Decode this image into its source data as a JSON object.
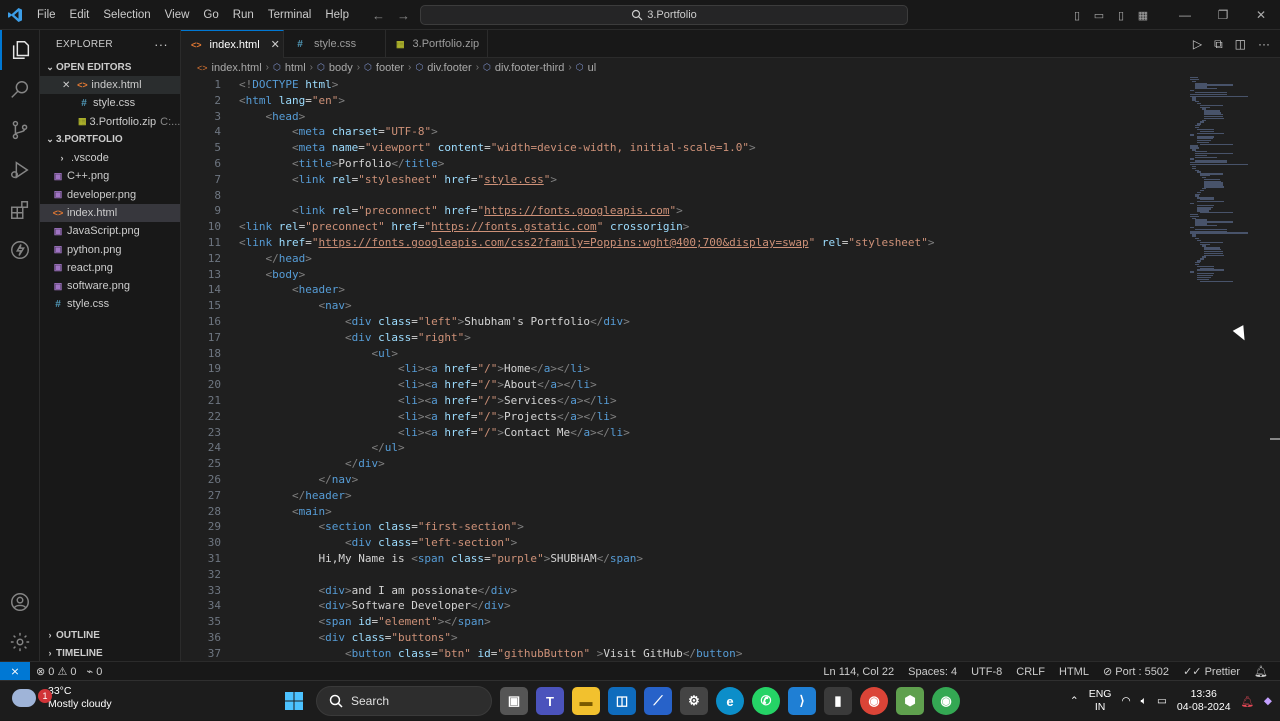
{
  "titlebar": {
    "menu": [
      "File",
      "Edit",
      "Selection",
      "View",
      "Go",
      "Run",
      "Terminal",
      "Help"
    ],
    "search_text": "3.Portfolio"
  },
  "explorer": {
    "header": "EXPLORER",
    "open_editors_title": "OPEN EDITORS",
    "open_editors": [
      {
        "name": "index.html",
        "type": "html"
      },
      {
        "name": "style.css",
        "type": "css"
      },
      {
        "name": "3.Portfolio.zip",
        "type": "zip",
        "detail": "C:..."
      }
    ],
    "folder_title": "3.PORTFOLIO",
    "files": [
      {
        "name": ".vscode",
        "type": "folder"
      },
      {
        "name": "C++.png",
        "type": "png"
      },
      {
        "name": "developer.png",
        "type": "png"
      },
      {
        "name": "index.html",
        "type": "html"
      },
      {
        "name": "JavaScript.png",
        "type": "png"
      },
      {
        "name": "python.png",
        "type": "png"
      },
      {
        "name": "react.png",
        "type": "png"
      },
      {
        "name": "software.png",
        "type": "png"
      },
      {
        "name": "style.css",
        "type": "css"
      }
    ],
    "outline_title": "OUTLINE",
    "timeline_title": "TIMELINE"
  },
  "tabs": [
    {
      "label": "index.html",
      "type": "html",
      "active": true
    },
    {
      "label": "style.css",
      "type": "css",
      "active": false
    },
    {
      "label": "3.Portfolio.zip",
      "type": "zip",
      "active": false
    }
  ],
  "breadcrumb": [
    "index.html",
    "html",
    "body",
    "footer",
    "div.footer",
    "div.footer-third",
    "ul"
  ],
  "code_lines": [
    "<!DOCTYPE html>",
    "<html lang=\"en\">",
    "    <head>",
    "        <meta charset=\"UTF-8\">",
    "        <meta name=\"viewport\" content=\"width=device-width, initial-scale=1.0\">",
    "        <title>Porfolio</title>",
    "        <link rel=\"stylesheet\" href=\"style.css\">",
    "",
    "        <link rel=\"preconnect\" href=\"https://fonts.googleapis.com\">",
    "<link rel=\"preconnect\" href=\"https://fonts.gstatic.com\" crossorigin>",
    "<link href=\"https://fonts.googleapis.com/css2?family=Poppins:wght@400;700&display=swap\" rel=\"stylesheet\">",
    "    </head>",
    "    <body>",
    "        <header>",
    "            <nav>",
    "                <div class=\"left\">Shubham's Portfolio</div>",
    "                <div class=\"right\">",
    "                    <ul>",
    "                        <li><a href=\"/\">Home</a></li>",
    "                        <li><a href=\"/\">About</a></li>",
    "                        <li><a href=\"/\">Services</a></li>",
    "                        <li><a href=\"/\">Projects</a></li>",
    "                        <li><a href=\"/\">Contact Me</a></li>",
    "                    </ul>",
    "                </div>",
    "            </nav>",
    "        </header>",
    "        <main>",
    "            <section class=\"first-section\">",
    "                <div class=\"left-section\">",
    "            Hi,My Name is <span class=\"purple\">SHUBHAM</span>",
    "",
    "            <div>and I am possionate</div>",
    "            <div>Software Developer</div>",
    "            <span id=\"element\"></span>",
    "            <div class=\"buttons\">",
    "                <button class=\"btn\" id=\"githubButton\" >Visit GitHub</button>"
  ],
  "status": {
    "errors": "0",
    "warnings": "0",
    "ports": "0",
    "position": "Ln 114, Col 22",
    "spaces": "Spaces: 4",
    "encoding": "UTF-8",
    "eol": "CRLF",
    "language": "HTML",
    "port": "Port : 5502",
    "formatter": "Prettier"
  },
  "taskbar": {
    "weather_temp": "33°C",
    "weather_desc": "Mostly cloudy",
    "weather_badge": "1",
    "search_label": "Search",
    "lang_top": "ENG",
    "lang_bottom": "IN",
    "time": "13:36",
    "date": "04-08-2024"
  },
  "colors": {
    "accent": "#0078d4",
    "editor_bg": "#1f1f1f",
    "tag": "#569cd6",
    "attr": "#9cdcfe",
    "string": "#ce9178"
  }
}
